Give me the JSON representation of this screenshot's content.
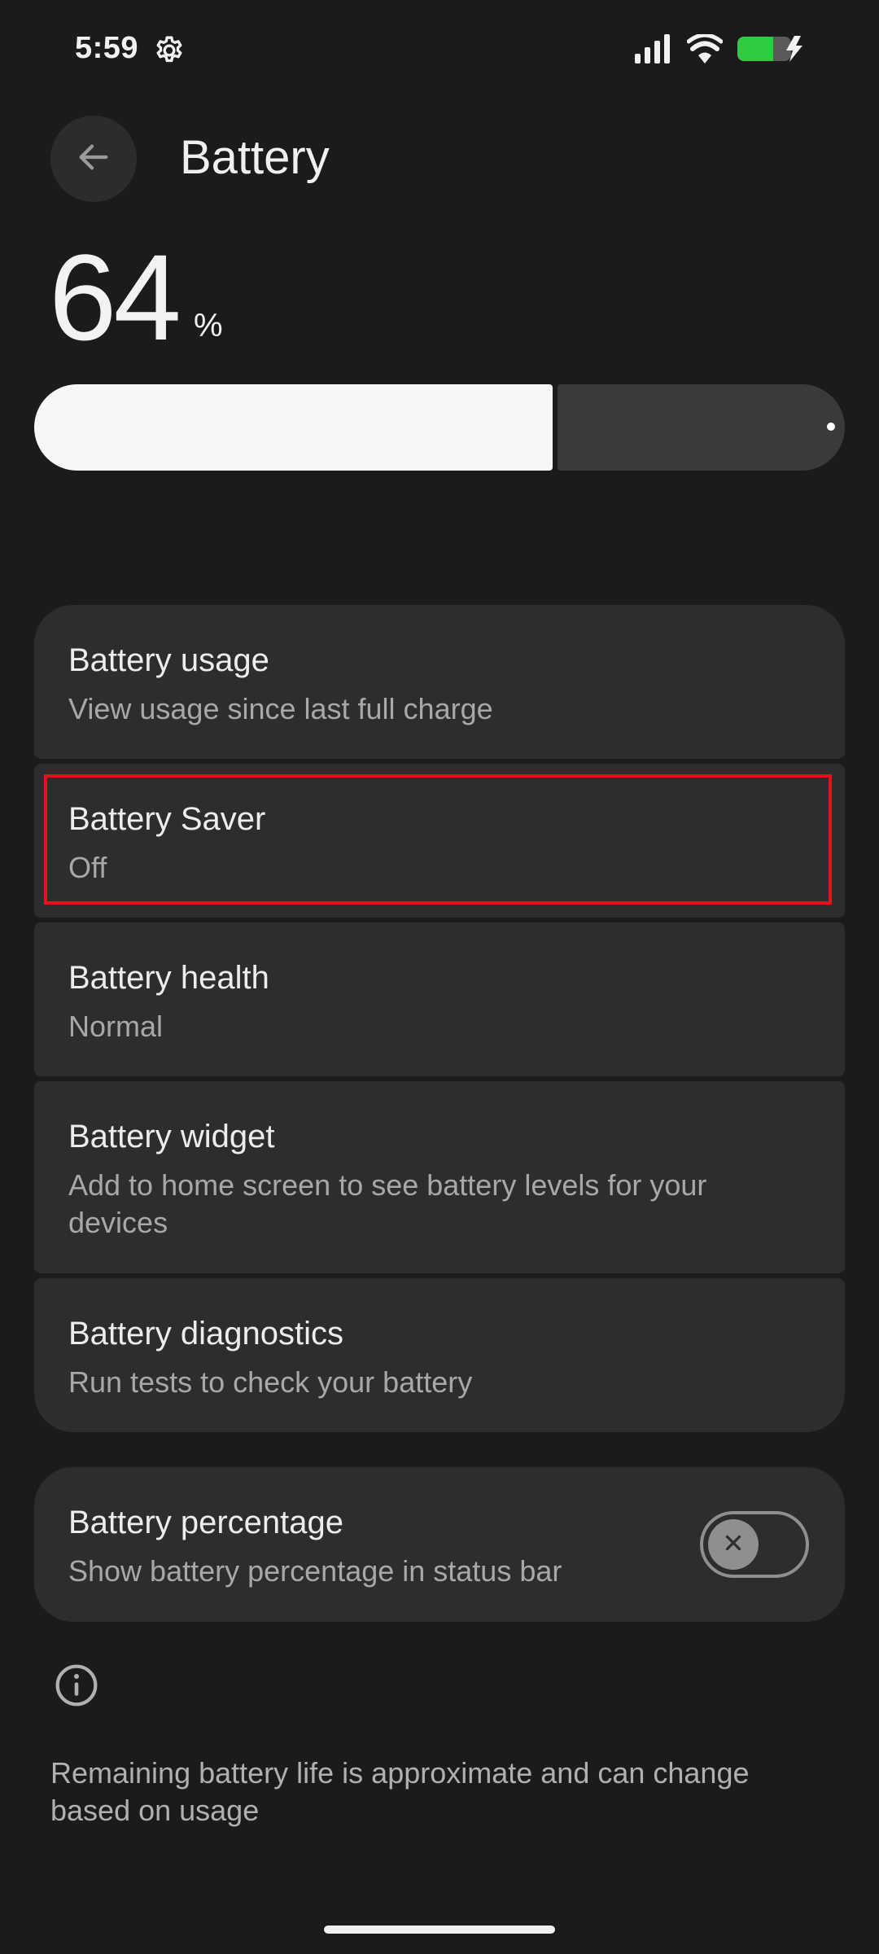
{
  "status_bar": {
    "time": "5:59",
    "battery_color": "#2ecc40",
    "icons": [
      "gear-icon",
      "signal-icon",
      "wifi-icon",
      "battery-charging-icon"
    ]
  },
  "header": {
    "title": "Battery",
    "back_icon": "arrow-left-icon"
  },
  "battery_level": {
    "value": "64",
    "unit": "%",
    "fraction": 0.64
  },
  "settings": [
    {
      "title": "Battery usage",
      "subtitle": "View usage since last full charge"
    },
    {
      "title": "Battery Saver",
      "subtitle": "Off"
    },
    {
      "title": "Battery health",
      "subtitle": "Normal"
    },
    {
      "title": "Battery widget",
      "subtitle": "Add to home screen to see battery levels for your devices"
    },
    {
      "title": "Battery diagnostics",
      "subtitle": "Run tests to check your battery"
    }
  ],
  "percentage_setting": {
    "title": "Battery percentage",
    "subtitle": "Show battery percentage in status bar",
    "toggle_state": "off"
  },
  "footer": {
    "info_icon": "info-icon",
    "text": "Remaining battery life is approximate and can change based on usage"
  },
  "colors": {
    "background": "#1b1b1b",
    "card": "#2d2d2d",
    "highlight": "#e0141b"
  }
}
